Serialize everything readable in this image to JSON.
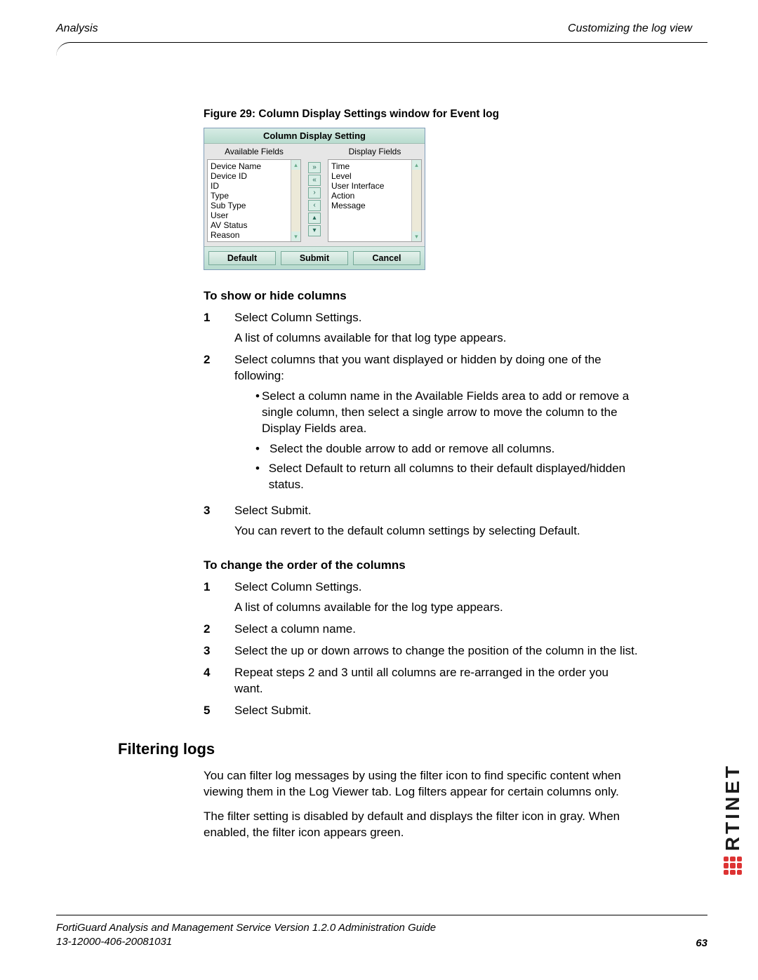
{
  "header": {
    "left": "Analysis",
    "right": "Customizing the log view"
  },
  "figure_caption": "Figure 29: Column Display Settings window for Event log",
  "dialog": {
    "title": "Column Display Setting",
    "left_header": "Available Fields",
    "right_header": "Display Fields",
    "available": [
      "Device Name",
      "Device ID",
      "ID",
      "Type",
      "Sub Type",
      "User",
      "AV Status",
      "Reason"
    ],
    "display": [
      "Time",
      "Level",
      "User Interface",
      "Action",
      "Message"
    ],
    "buttons": {
      "default": "Default",
      "submit": "Submit",
      "cancel": "Cancel"
    }
  },
  "section1_heading": "To show or hide columns",
  "s1": {
    "n1": "1",
    "t1a": "Select Column Settings.",
    "t1b": "A list of columns available for that log type appears.",
    "n2": "2",
    "t2": "Select columns that you want displayed or hidden by doing one of the following:",
    "b1": "Select a column name in the Available Fields area to add or remove a single column, then select a single arrow to move the column to the Display Fields area.",
    "b2": "Select the double arrow to add or remove all columns.",
    "b3": "Select Default to return all columns to their default displayed/hidden status.",
    "n3": "3",
    "t3a": "Select Submit.",
    "t3b": "You can revert to the default column settings by selecting Default."
  },
  "section2_heading": "To change the order of the columns",
  "s2": {
    "n1": "1",
    "t1a": "Select Column Settings.",
    "t1b": "A list of columns available for the log type appears.",
    "n2": "2",
    "t2": "Select a column name.",
    "n3": "3",
    "t3": "Select the up or down arrows to change the position of the column in the list.",
    "n4": "4",
    "t4": "Repeat steps 2 and 3 until all columns are re-arranged in the order you want.",
    "n5": "5",
    "t5": "Select Submit."
  },
  "h2": "Filtering logs",
  "filtering": {
    "p1": "You can filter log messages by using the filter icon to find specific content when viewing them in the Log Viewer tab. Log filters appear for certain columns only.",
    "p2": "The filter setting is disabled by default and displays the filter icon in gray. When enabled, the filter icon appears green."
  },
  "footer": {
    "line1": "FortiGuard Analysis and Management Service Version 1.2.0 Administration Guide",
    "line2": "13-12000-406-20081031",
    "page": "63"
  },
  "logo_text": "RTINET"
}
